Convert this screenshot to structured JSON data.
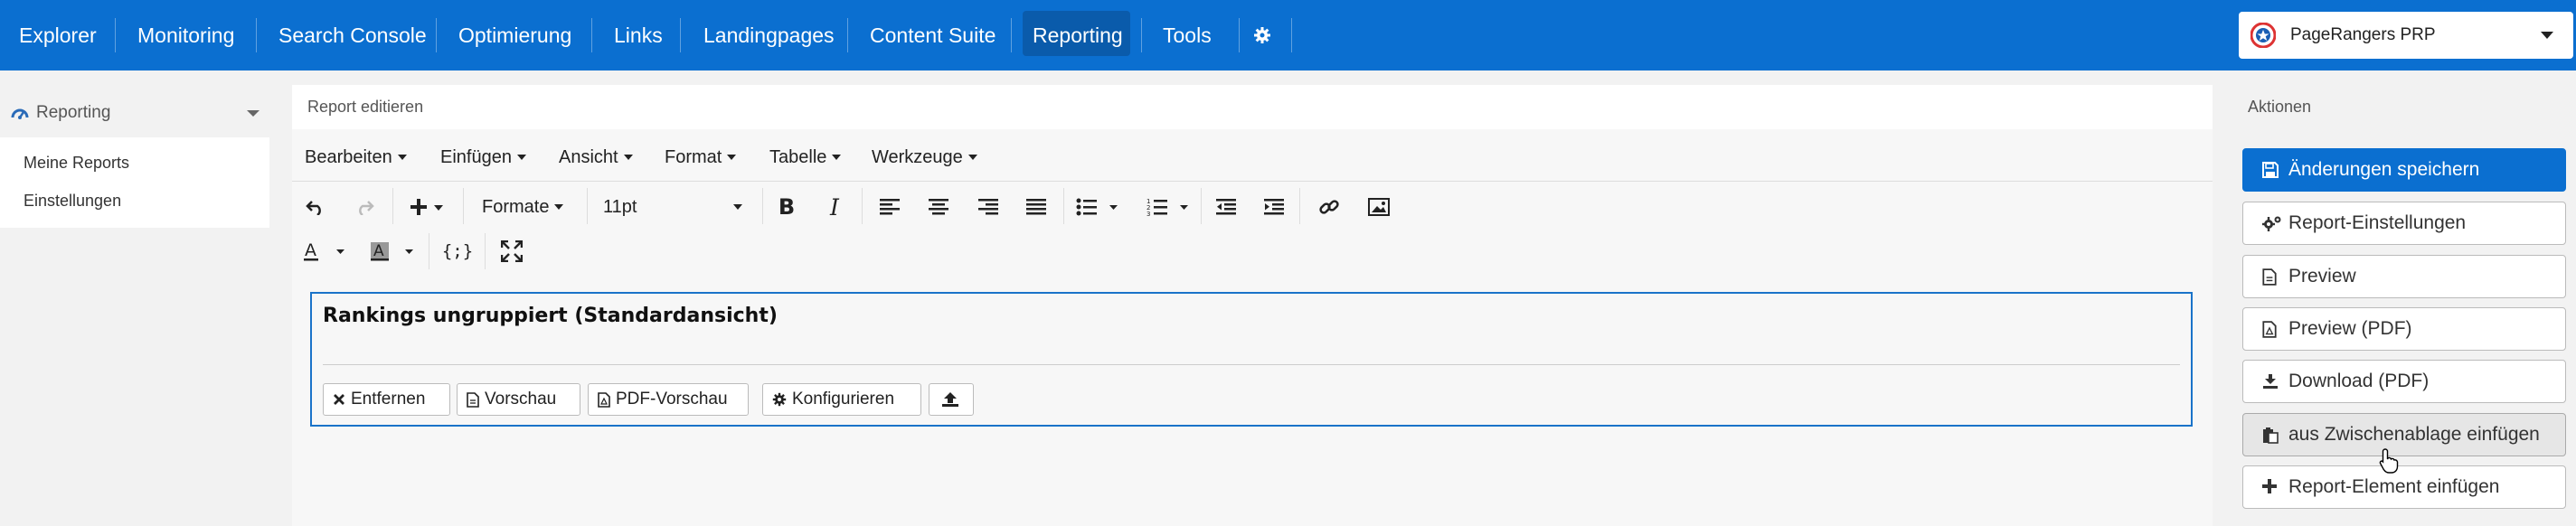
{
  "topnav": {
    "items": [
      "Explorer",
      "Monitoring",
      "Search Console",
      "Optimierung",
      "Links",
      "Landingpages",
      "Content Suite",
      "Reporting",
      "Tools"
    ],
    "active": "Reporting",
    "settings_icon": "gear-icon",
    "project": "PageRangers PRP"
  },
  "sidebar": {
    "section": "Reporting",
    "items": [
      "Meine Reports",
      "Einstellungen"
    ]
  },
  "editor": {
    "title": "Report editieren",
    "menubar": [
      "Bearbeiten",
      "Einfügen",
      "Ansicht",
      "Format",
      "Tabelle",
      "Werkzeuge"
    ],
    "formats_label": "Formate",
    "font_size": "11pt",
    "report_heading": "Rankings ungruppiert (Standardansicht)",
    "element_buttons": {
      "remove": "Entfernen",
      "preview": "Vorschau",
      "pdf_preview": "PDF-Vorschau",
      "configure": "Konfigurieren"
    }
  },
  "actions": {
    "title": "Aktionen",
    "save": "Änderungen speichern",
    "settings": "Report-Einstellungen",
    "preview": "Preview",
    "preview_pdf": "Preview (PDF)",
    "download_pdf": "Download (PDF)",
    "paste_clipboard": "aus Zwischenablage einfügen",
    "insert_element": "Report-Element einfügen"
  },
  "colors": {
    "brand": "#0b6fd0",
    "active_nav": "#0a5bab",
    "focus_border": "#1a73c9"
  }
}
